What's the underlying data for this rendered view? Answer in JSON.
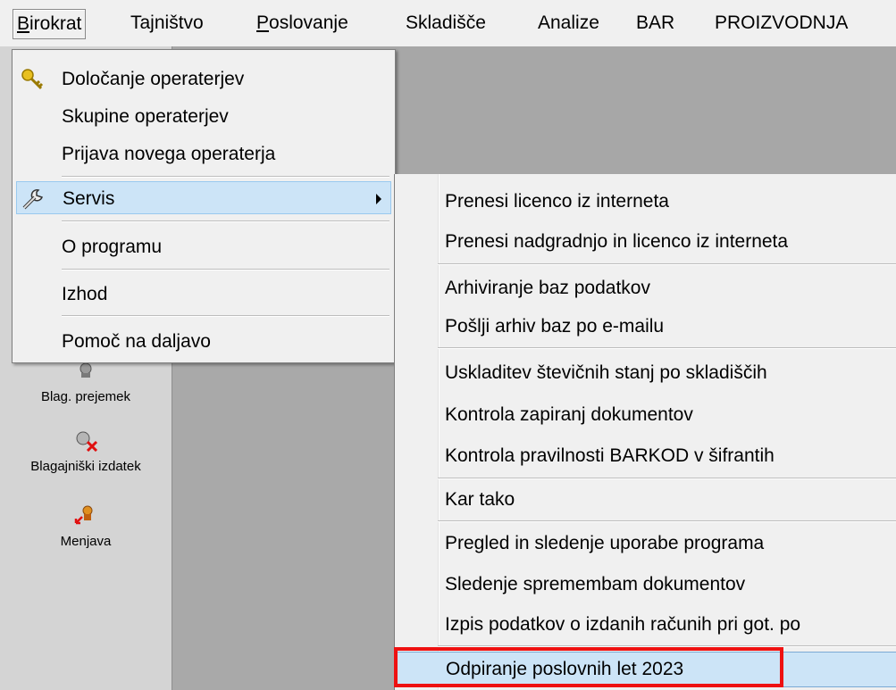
{
  "menubar": {
    "items": [
      "Birokrat",
      "Tajništvo",
      "Poslovanje",
      "Skladišče",
      "Analize",
      "BAR",
      "PROIZVODNJA"
    ]
  },
  "sidebar": {
    "items": [
      {
        "label": "Blag. prejemek",
        "icon": "receipt-icon"
      },
      {
        "label": "Blagajniški izdatek",
        "icon": "cash-expense-icon"
      },
      {
        "label": "Menjava",
        "icon": "exchange-icon"
      }
    ]
  },
  "dropdown": {
    "items": [
      {
        "label": "Določanje operaterjev",
        "icon": "key-icon"
      },
      {
        "label": "Skupine operaterjev"
      },
      {
        "label": "Prijava novega operaterja"
      },
      {
        "label": "Servis",
        "icon": "wrench-icon",
        "highlighted": true
      },
      {
        "label": "O programu"
      },
      {
        "label": "Izhod"
      },
      {
        "label": "Pomoč na daljavo"
      }
    ]
  },
  "submenu": {
    "items": [
      "Prenesi licenco iz interneta",
      "Prenesi nadgradnjo in licenco iz interneta",
      "Arhiviranje baz podatkov",
      "Pošlji arhiv baz po e-mailu",
      "Uskladitev števičnih stanj po skladiščih",
      "Kontrola zapiranj dokumentov",
      "Kontrola pravilnosti BARKOD v šifrantih",
      "Kar tako",
      "Pregled in sledenje uporabe programa",
      "Sledenje spremembam dokumentov",
      "Izpis podatkov o izdanih računih pri got. po",
      "Odpiranje poslovnih let 2023"
    ]
  },
  "colors": {
    "highlight": "#cce4f7",
    "annotation_box": "#ee1111"
  }
}
